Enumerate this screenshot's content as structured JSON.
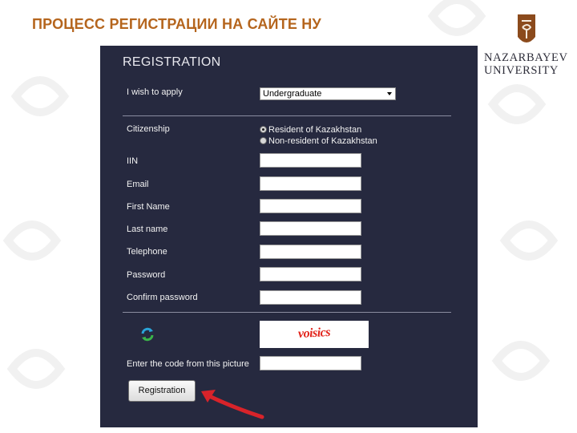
{
  "slide": {
    "title": "ПРОЦЕСС РЕГИСТРАЦИИ НА САЙТЕ НУ"
  },
  "logo": {
    "line1": "NAZARBAYEV",
    "line2": "UNIVERSITY"
  },
  "form": {
    "title": "REGISTRATION",
    "apply": {
      "label": "I wish to apply",
      "selected": "Undergraduate"
    },
    "citizenship": {
      "label": "Citizenship",
      "options": [
        {
          "label": "Resident of Kazakhstan",
          "checked": true
        },
        {
          "label": "Non-resident of Kazakhstan",
          "checked": false
        }
      ]
    },
    "fields": [
      {
        "label": "IIN",
        "value": ""
      },
      {
        "label": "Email",
        "value": ""
      },
      {
        "label": "First Name",
        "value": ""
      },
      {
        "label": "Last name",
        "value": ""
      },
      {
        "label": "Telephone",
        "value": ""
      },
      {
        "label": "Password",
        "value": ""
      },
      {
        "label": "Confirm password",
        "value": ""
      }
    ],
    "captcha": {
      "image_text": "voisics",
      "code_label": "Enter the code from this picture",
      "code_value": ""
    },
    "submit_label": "Registration"
  },
  "icons": {
    "refresh": "refresh-icon",
    "arrow": "red-arrow-annotation"
  },
  "colors": {
    "title": "#b5651d",
    "panel": "#26293f",
    "arrow": "#d8232a",
    "captcha_text": "#e2231a"
  }
}
